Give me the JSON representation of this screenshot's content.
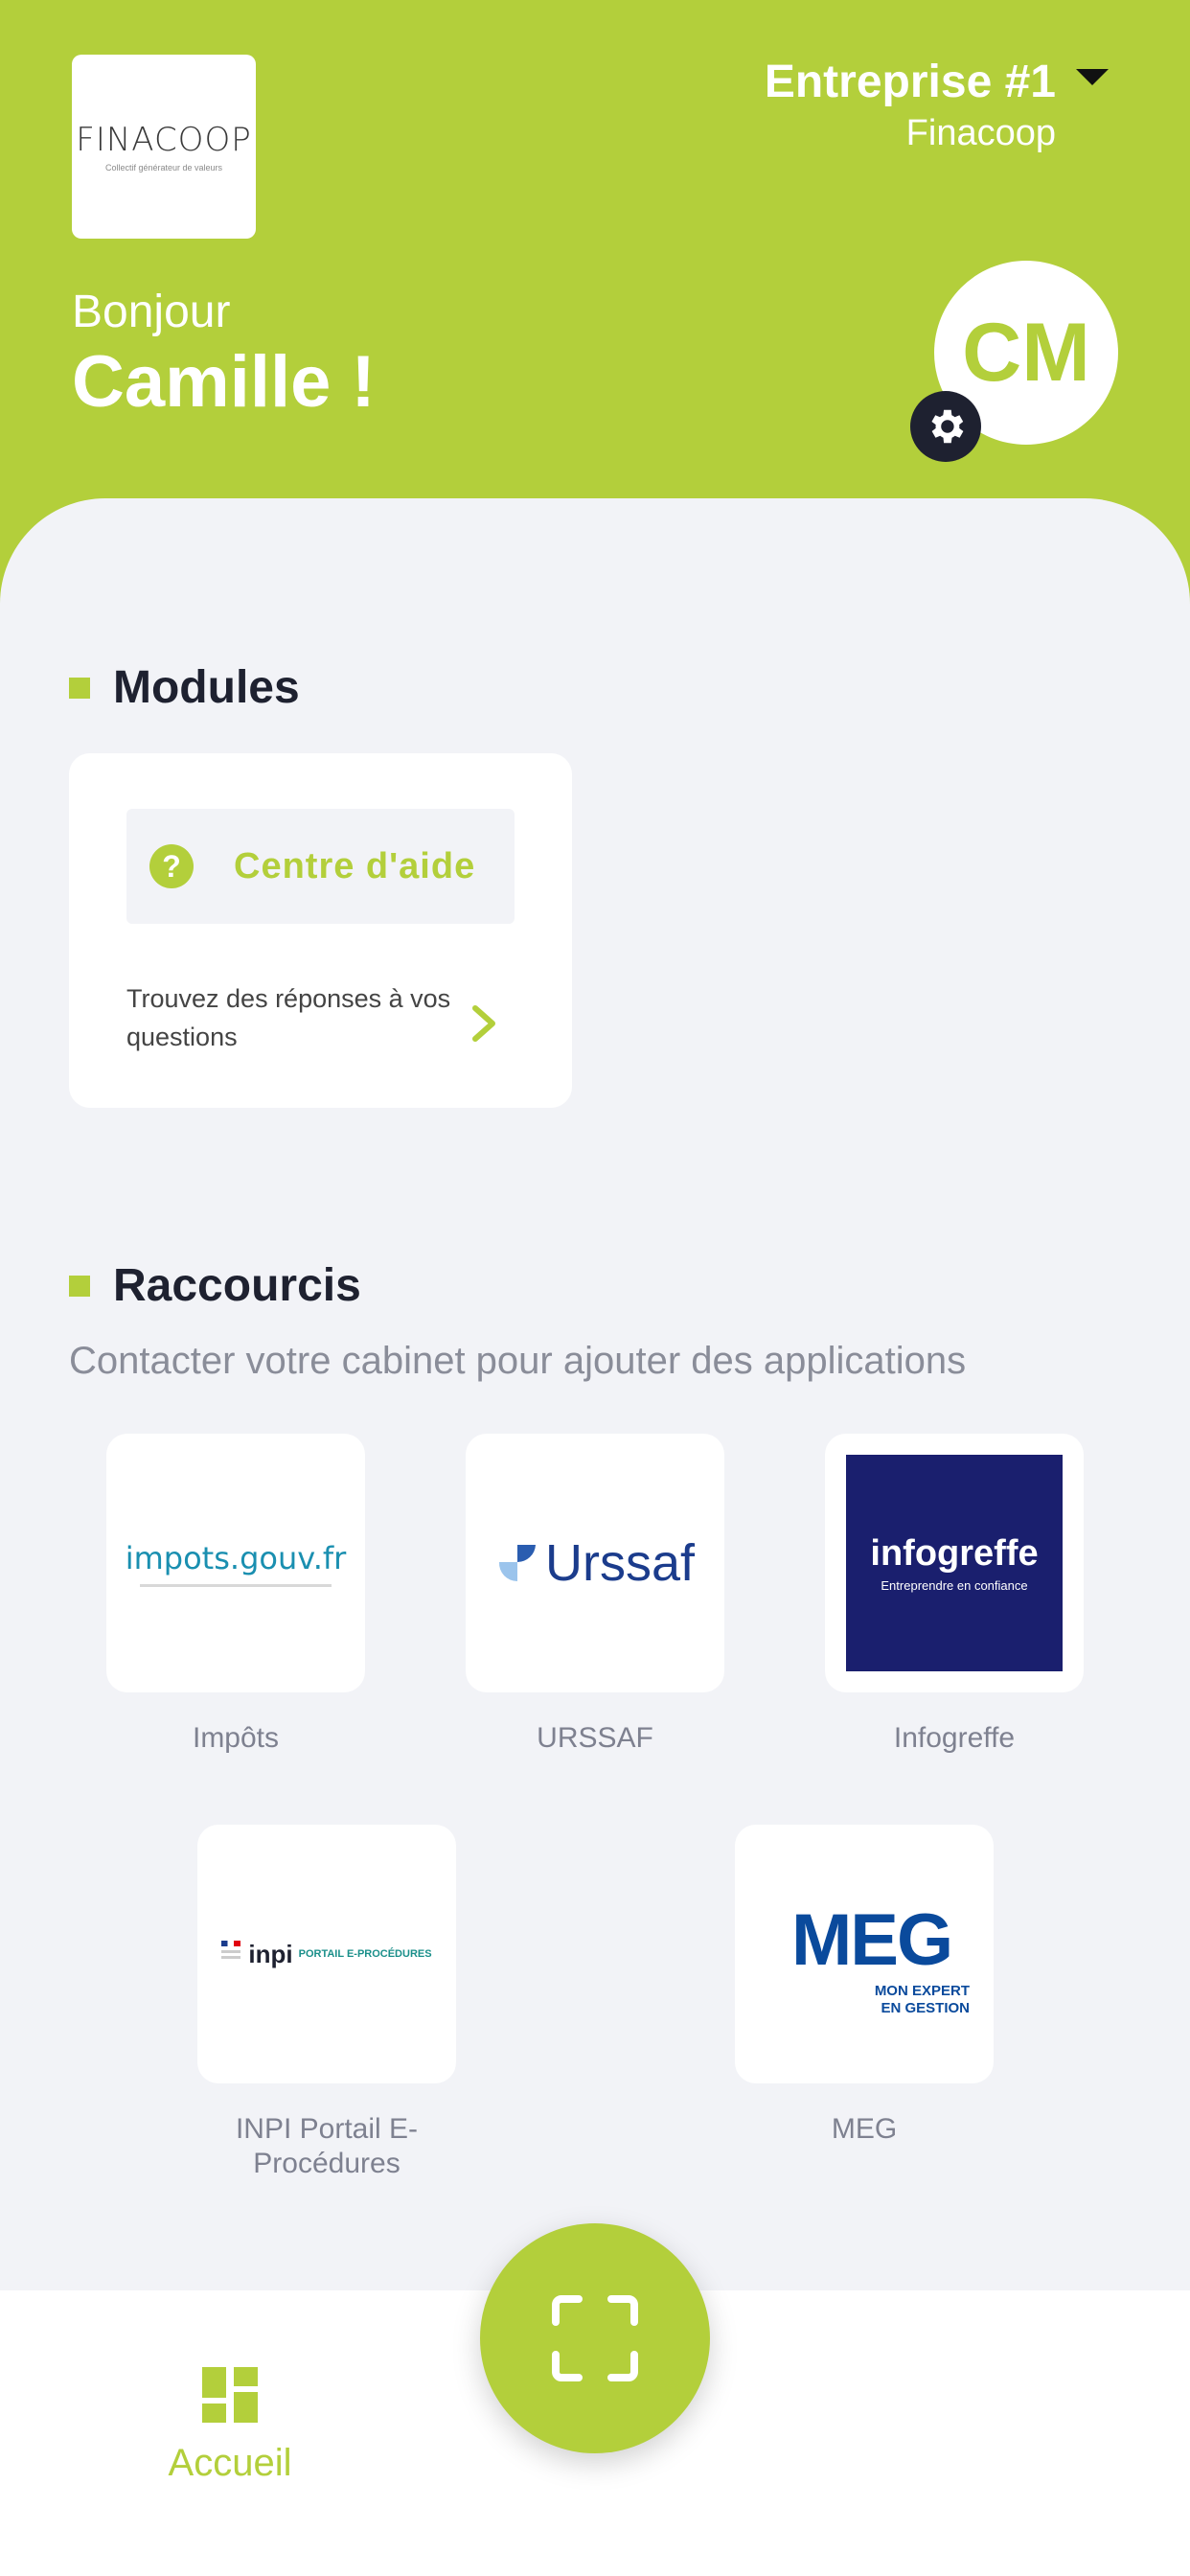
{
  "header": {
    "logo_text": "FINACOOP",
    "logo_tagline": "Collectif générateur de valeurs",
    "company_name": "Entreprise #1",
    "company_sub": "Finacoop",
    "greeting": "Bonjour",
    "user_name": "Camille !",
    "avatar_initials": "CM"
  },
  "modules": {
    "title": "Modules",
    "items": [
      {
        "label": "Centre d'aide",
        "description": "Trouvez des réponses à vos questions"
      }
    ]
  },
  "shortcuts": {
    "title": "Raccourcis",
    "subtitle": "Contacter votre cabinet pour ajouter des applications",
    "items": [
      {
        "label": "Impôts",
        "logo_text": "impots.gouv.fr"
      },
      {
        "label": "URSSAF",
        "logo_text": "Urssaf"
      },
      {
        "label": "Infogreffe",
        "logo_text": "infogreffe",
        "logo_tagline": "Entreprendre en confiance"
      },
      {
        "label": "INPI Portail E-Procédures",
        "logo_text": "inpi",
        "logo_tagline": "PORTAIL E-PROCÉDURES"
      },
      {
        "label": "MEG",
        "logo_text": "MEG",
        "logo_tagline": "MON EXPERT EN GESTION"
      }
    ]
  },
  "nav": {
    "home_label": "Accueil"
  },
  "colors": {
    "accent": "#b3cf3b",
    "dark": "#1e2130",
    "background": "#f2f3f7",
    "infogreffe_blue": "#1a1f6e",
    "meg_blue": "#0a4a9c"
  }
}
